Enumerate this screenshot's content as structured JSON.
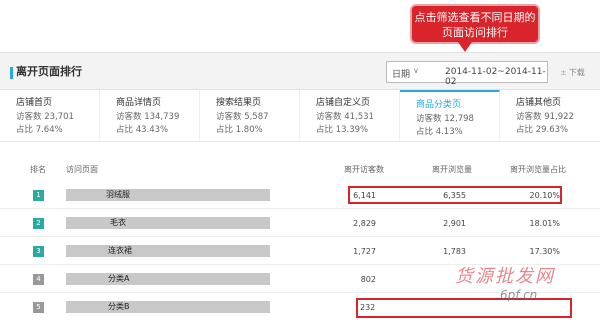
{
  "callout": {
    "text": "点击筛选查看不同日期的页面访问排行"
  },
  "header": {
    "title": "离开页面排行",
    "date_label": "日期",
    "date_caret": "∨",
    "date_value": "2014-11-02~2014-11-02",
    "download_label": "下载",
    "download_icon": "±"
  },
  "tabs": [
    {
      "name": "店铺首页",
      "visitors": "访客数 23,701",
      "ratio": "占比 7.64%"
    },
    {
      "name": "商品详情页",
      "visitors": "访客数 134,739",
      "ratio": "占比 43.43%"
    },
    {
      "name": "搜索结果页",
      "visitors": "访客数 5,587",
      "ratio": "占比 1.80%"
    },
    {
      "name": "店铺自定义页",
      "visitors": "访客数 41,531",
      "ratio": "占比 13.39%"
    },
    {
      "name": "商品分类页",
      "visitors": "访客数 12,798",
      "ratio": "占比 4.13%"
    },
    {
      "name": "店铺其他页",
      "visitors": "访客数 91,922",
      "ratio": "占比 29.63%"
    }
  ],
  "table": {
    "headers": {
      "rank": "排名",
      "page": "访问页面",
      "visitors": "离开访客数",
      "views": "离开浏览量",
      "ratio": "离开浏览量占比"
    },
    "rows": [
      {
        "rank": "1",
        "page": "羽绒服",
        "visitors": "6,141",
        "views": "6,355",
        "ratio": "20.10%"
      },
      {
        "rank": "2",
        "page": "毛衣",
        "visitors": "2,829",
        "views": "2,901",
        "ratio": "18.01%"
      },
      {
        "rank": "3",
        "page": "连衣裙",
        "visitors": "1,727",
        "views": "1,783",
        "ratio": "17.30%"
      },
      {
        "rank": "4",
        "page": "分类A",
        "visitors": "802",
        "views": "",
        "ratio": ""
      },
      {
        "rank": "5",
        "page": "分类B",
        "visitors": "232",
        "views": "",
        "ratio": ""
      }
    ]
  },
  "watermark": {
    "text": "货源批发网",
    "site": "6pf.cn"
  }
}
